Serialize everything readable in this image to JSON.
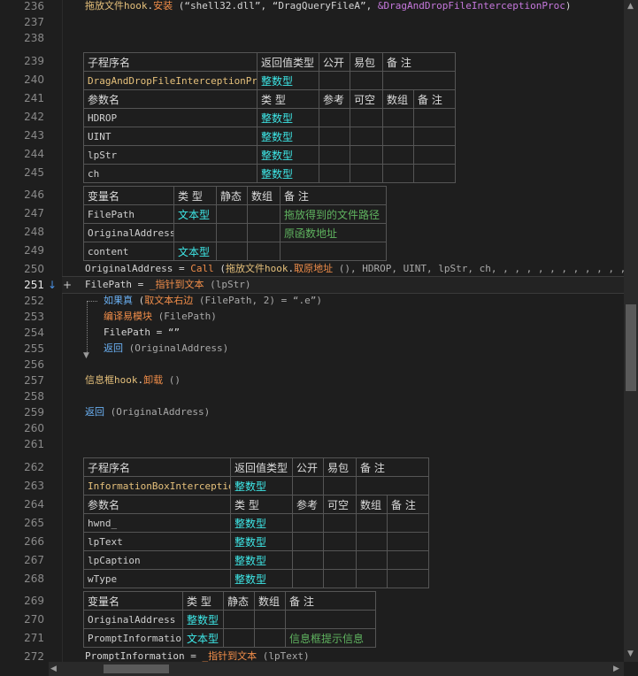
{
  "line_numbers": [
    "236",
    "237",
    "238",
    "239",
    "240",
    "241",
    "242",
    "243",
    "244",
    "245",
    "246",
    "247",
    "248",
    "249",
    "250",
    "251",
    "252",
    "253",
    "254",
    "255",
    "256",
    "257",
    "258",
    "259",
    "260",
    "261",
    "262",
    "263",
    "264",
    "265",
    "266",
    "267",
    "268",
    "269",
    "270",
    "271",
    "272"
  ],
  "code": {
    "l236_obj": "拖放文件hook",
    "l236_dot": ".",
    "l236_method": "安装",
    "l236_args_a": " (“shell32.dll”, “DragQueryFileA”, ",
    "l236_addr": "&DragAndDropFileInterceptionProc",
    "l236_args_b": ")",
    "l250_a": "OriginalAddress = ",
    "l250_call": "Call",
    "l250_b": " (",
    "l250_obj": "拖放文件hook",
    "l250_dot": ".",
    "l250_method": "取原地址",
    "l250_c": " (), HDROP, UINT, lpStr, ch, , , , , , , , , , , , )",
    "l251_a": "FilePath = ",
    "l251_fn": "_指针到文本",
    "l251_b": " (lpStr)",
    "l252_kw": "如果真",
    "l252_a": " (",
    "l252_fn": "取文本右边",
    "l252_b": " (FilePath, 2) = “.e”)",
    "l253_fn": "编译易模块",
    "l253_a": " (FilePath)",
    "l254": "FilePath = “”",
    "l255_kw": "返回",
    "l255_a": " (OriginalAddress)",
    "l257_obj": "信息框hook",
    "l257_dot": ".",
    "l257_method": "卸载",
    "l257_a": " ()",
    "l259_kw": "返回",
    "l259_a": " (OriginalAddress)",
    "l272_a": "PromptInformation = ",
    "l272_fn": "_指针到文本",
    "l272_b": " (lpText)"
  },
  "sub1": {
    "head": {
      "name": "子程序名",
      "ret": "返回值类型",
      "pub": "公开",
      "easy": "易包",
      "note": "备 注"
    },
    "row": {
      "name": "DragAndDropFileInterceptionProc",
      "ret": "整数型"
    },
    "param_head": {
      "name": "参数名",
      "type": "类 型",
      "ref": "参考",
      "opt": "可空",
      "arr": "数组",
      "note": "备 注"
    },
    "params": [
      {
        "name": "HDROP",
        "type": "整数型"
      },
      {
        "name": "UINT",
        "type": "整数型"
      },
      {
        "name": "lpStr",
        "type": "整数型"
      },
      {
        "name": "ch",
        "type": "整数型"
      }
    ],
    "var_head": {
      "name": "变量名",
      "type": "类 型",
      "static": "静态",
      "arr": "数组",
      "note": "备 注"
    },
    "vars": [
      {
        "name": "FilePath",
        "type": "文本型",
        "note": "拖放得到的文件路径"
      },
      {
        "name": "OriginalAddress",
        "type": "",
        "note": "原函数地址"
      },
      {
        "name": "content",
        "type": "文本型",
        "note": ""
      }
    ]
  },
  "sub2": {
    "head": {
      "name": "子程序名",
      "ret": "返回值类型",
      "pub": "公开",
      "easy": "易包",
      "note": "备 注"
    },
    "row": {
      "name": "InformationBoxInterception",
      "ret": "整数型"
    },
    "param_head": {
      "name": "参数名",
      "type": "类 型",
      "ref": "参考",
      "opt": "可空",
      "arr": "数组",
      "note": "备 注"
    },
    "params": [
      {
        "name": "hwnd_",
        "type": "整数型"
      },
      {
        "name": "lpText",
        "type": "整数型"
      },
      {
        "name": "lpCaption",
        "type": "整数型"
      },
      {
        "name": "wType",
        "type": "整数型"
      }
    ],
    "var_head": {
      "name": "变量名",
      "type": "类 型",
      "static": "静态",
      "arr": "数组",
      "note": "备 注"
    },
    "vars": [
      {
        "name": "OriginalAddress",
        "type": "整数型",
        "note": ""
      },
      {
        "name": "PromptInformation",
        "type": "文本型",
        "note": "信息框提示信息"
      }
    ]
  },
  "gutter_icons": {
    "breakpoint": "↓",
    "add": "+"
  },
  "colors": {
    "background": "#1e1e1e",
    "keyword": "#6ab0f3",
    "function": "#f08d49",
    "object": "#e5c07b",
    "type": "#3ee8e8",
    "comment": "#5fb35f"
  }
}
